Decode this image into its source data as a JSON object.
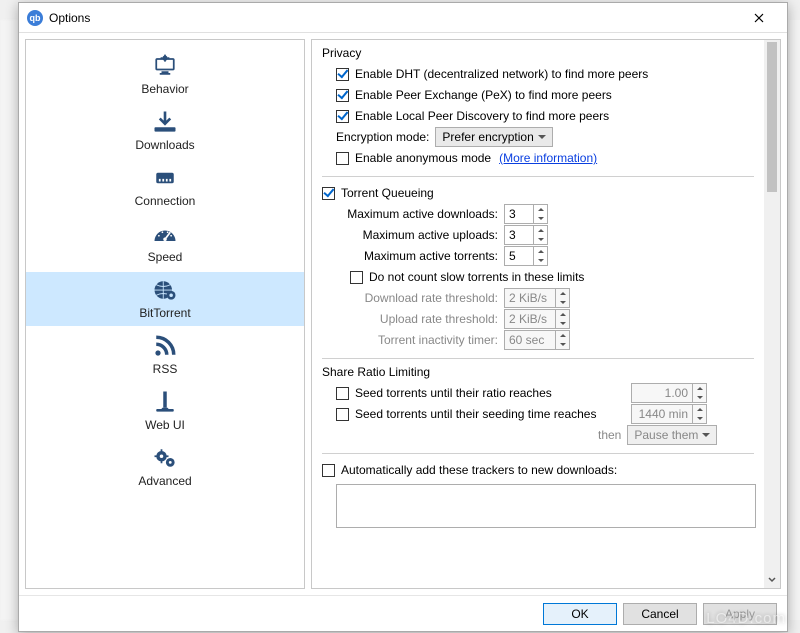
{
  "window": {
    "title": "Options"
  },
  "sidebar": {
    "items": [
      {
        "label": "Behavior"
      },
      {
        "label": "Downloads"
      },
      {
        "label": "Connection"
      },
      {
        "label": "Speed"
      },
      {
        "label": "BitTorrent"
      },
      {
        "label": "RSS"
      },
      {
        "label": "Web UI"
      },
      {
        "label": "Advanced"
      }
    ],
    "selected_index": 4
  },
  "privacy": {
    "title": "Privacy",
    "dht": {
      "label": "Enable DHT (decentralized network) to find more peers",
      "checked": true
    },
    "pex": {
      "label": "Enable Peer Exchange (PeX) to find more peers",
      "checked": true
    },
    "lpd": {
      "label": "Enable Local Peer Discovery to find more peers",
      "checked": true
    },
    "encryption_label": "Encryption mode:",
    "encryption_value": "Prefer encryption",
    "anonymous": {
      "label": "Enable anonymous mode",
      "checked": false
    },
    "more_info": "(More information)"
  },
  "queueing": {
    "title": "Torrent Queueing",
    "enabled": true,
    "max_downloads_label": "Maximum active downloads:",
    "max_downloads_value": "3",
    "max_uploads_label": "Maximum active uploads:",
    "max_uploads_value": "3",
    "max_torrents_label": "Maximum active torrents:",
    "max_torrents_value": "5",
    "slow": {
      "label": "Do not count slow torrents in these limits",
      "checked": false,
      "dl_label": "Download rate threshold:",
      "dl_value": "2 KiB/s",
      "ul_label": "Upload rate threshold:",
      "ul_value": "2 KiB/s",
      "inact_label": "Torrent inactivity timer:",
      "inact_value": "60 sec"
    }
  },
  "share": {
    "title": "Share Ratio Limiting",
    "ratio": {
      "label": "Seed torrents until their ratio reaches",
      "checked": false,
      "value": "1.00"
    },
    "time": {
      "label": "Seed torrents until their seeding time reaches",
      "checked": false,
      "value": "1440 min"
    },
    "then_label": "then",
    "then_value": "Pause them"
  },
  "trackers": {
    "label": "Automatically add these trackers to new downloads:",
    "checked": false,
    "value": ""
  },
  "footer": {
    "ok": "OK",
    "cancel": "Cancel",
    "apply": "Apply"
  },
  "watermark": "LO4D.com"
}
